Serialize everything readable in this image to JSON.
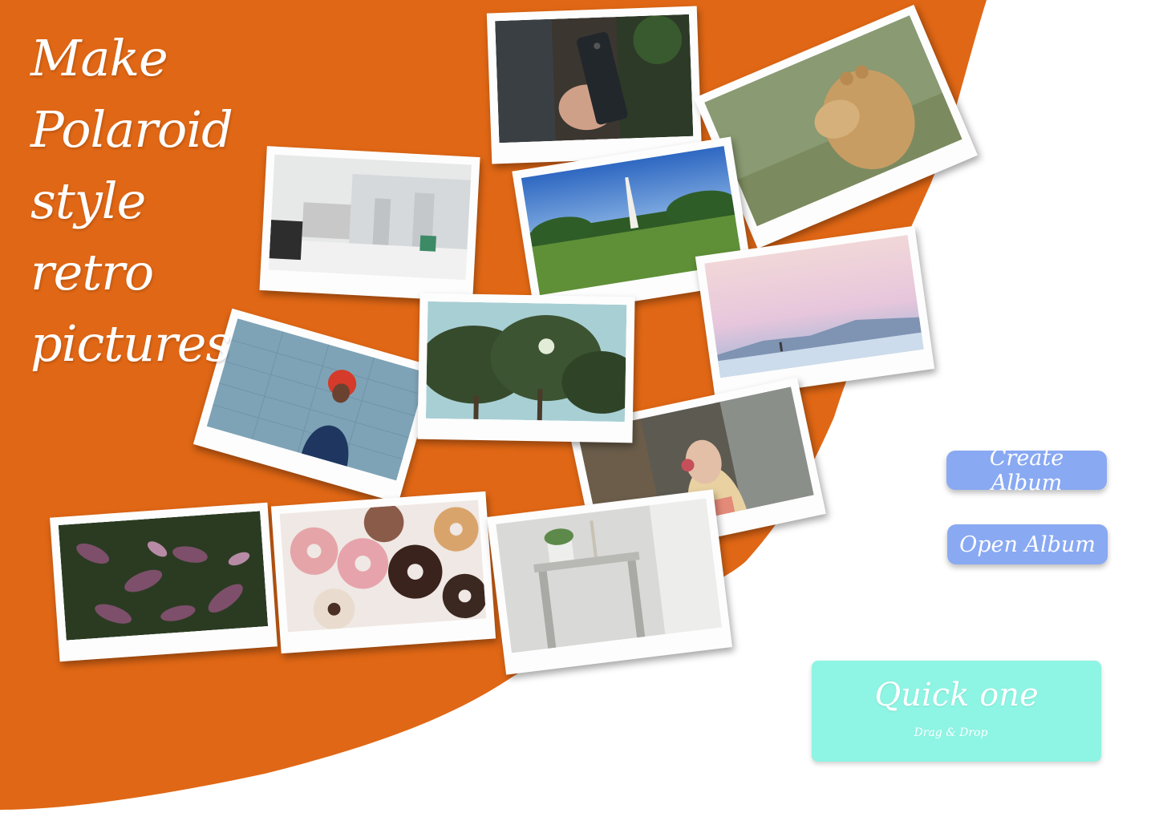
{
  "theme": {
    "background": "#ffffff",
    "accent_orange": "#e06715",
    "button_blue": "#89a9f2",
    "button_mint": "#8ef4e3",
    "text_on_color": "#ffffff"
  },
  "headline": {
    "lines": [
      "Make",
      "Polaroid",
      "style",
      "retro",
      "pictures"
    ]
  },
  "actions": {
    "create_album": "Create Album",
    "open_album": "Open Album",
    "quick_title": "Quick one",
    "quick_subtitle": "Drag & Drop"
  },
  "photos": [
    {
      "subject": "hand-holding-phone"
    },
    {
      "subject": "lioness"
    },
    {
      "subject": "office-desk-computer"
    },
    {
      "subject": "monument-park"
    },
    {
      "subject": "pastel-sky-desert"
    },
    {
      "subject": "woman-pointing-blue-wall"
    },
    {
      "subject": "tree-canopy"
    },
    {
      "subject": "girl-headphones"
    },
    {
      "subject": "purple-leaves"
    },
    {
      "subject": "donuts"
    },
    {
      "subject": "nightstand-plant"
    }
  ]
}
